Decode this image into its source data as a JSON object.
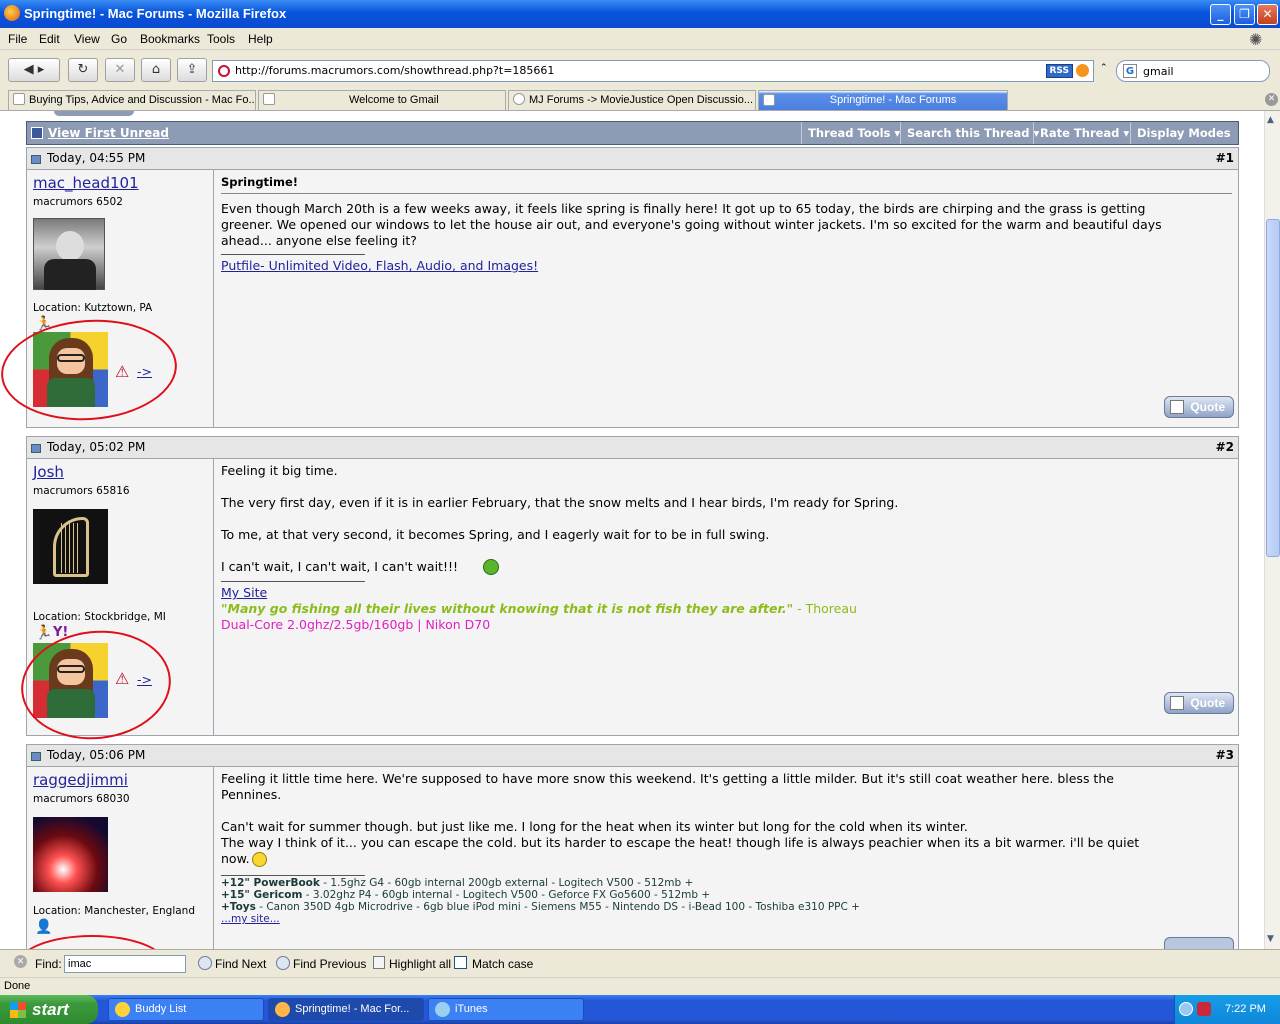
{
  "window": {
    "title": "Springtime! - Mac Forums - Mozilla Firefox"
  },
  "menu": [
    "File",
    "Edit",
    "View",
    "Go",
    "Bookmarks",
    "Tools",
    "Help"
  ],
  "nav": {
    "url": "http://forums.macrumors.com/showthread.php?t=185661",
    "rss": "RSS",
    "search_value": "gmail",
    "search_engine_glyph": "G"
  },
  "tabs": [
    {
      "label": "Buying Tips, Advice and Discussion - Mac Fo..."
    },
    {
      "label": "Welcome to Gmail"
    },
    {
      "label": "MJ Forums -> MovieJustice Open Discussio..."
    },
    {
      "label": "Springtime! - Mac Forums"
    }
  ],
  "thread": {
    "view_first_unread": "View First Unread",
    "tools": [
      "Thread Tools",
      "Search this Thread",
      "Rate Thread",
      "Display Modes"
    ]
  },
  "posts": [
    {
      "date": "Today, 04:55 PM",
      "num": "#1",
      "user": "mac_head101",
      "title": "macrumors 6502",
      "location": "Location: Kutztown, PA",
      "subject": "Springtime!",
      "body": "Even though March 20th is a few weeks away, it feels like spring is finally here! It got up to 65 today, the birds are chirping and the grass is getting\ngreener. We opened our windows to let the house air out, and everyone's going without winter jackets. I'm so excited for the warm and beautiful days\nahead... anyone else feeling it?",
      "sig": "Putfile- Unlimited Video, Flash, Audio, and Images!",
      "arrow": "->",
      "quote": "Quote"
    },
    {
      "date": "Today, 05:02 PM",
      "num": "#2",
      "user": "Josh",
      "title": "macrumors 65816",
      "location": "Location: Stockbridge, MI",
      "body": "Feeling it big time.\n\nThe very first day, even if it is in earlier February, that the snow melts and I hear birds, I'm ready for Spring.\n\nTo me, at that very second, it becomes Spring, and I eagerly wait for to be in full swing.\n\nI can't wait, I can't wait, I can't wait!!!",
      "sig_link": "My Site",
      "sig_quote": "\"Many go fishing all their lives without knowing that it is not fish they are after.\"",
      "sig_quote_author": " - Thoreau",
      "sig_specs": "Dual-Core 2.0ghz/2.5gb/160gb | Nikon D70",
      "arrow": "->",
      "quote": "Quote"
    },
    {
      "date": "Today, 05:06 PM",
      "num": "#3",
      "user": "raggedjimmi",
      "title": "macrumors 68030",
      "location": "Location: Manchester, England",
      "body": "Feeling it little time here. We're supposed to have more snow this weekend. It's getting a little milder. But it's still coat weather here. bless the\nPennines.\n\nCan't wait for summer though. but just like me. I long for the heat when its winter but long for the cold when its winter.\nThe way I think of it... you can escape the cold. but its harder to escape the heat! though life is always peachier when its a bit warmer. i'll be quiet\nnow.",
      "spec1_label": "+12\" PowerBook",
      "spec1": " - 1.5ghz G4 - 60gb internal 200gb external - Logitech V500 - 512mb +",
      "spec2_label": "+15\" Gericom",
      "spec2": " - 3.02ghz P4 - 60gb internal - Logitech V500 - Geforce FX Go5600 - 512mb +",
      "spec3_label": "+Toys",
      "spec3": " - Canon 350D 4gb Microdrive - 6gb blue iPod mini - Siemens M55 - Nintendo DS - i-Bead 100 - Toshiba e310 PPC +",
      "spec_link": "...my site..."
    }
  ],
  "find": {
    "label": "Find:",
    "value": "imac",
    "next": "Find Next",
    "prev": "Find Previous",
    "highlight": "Highlight all",
    "match": "Match case"
  },
  "status": "Done",
  "taskbar": {
    "start": "start",
    "tasks": [
      "Buddy List",
      "Springtime! - Mac For...",
      "iTunes"
    ],
    "clock": "7:22 PM"
  }
}
